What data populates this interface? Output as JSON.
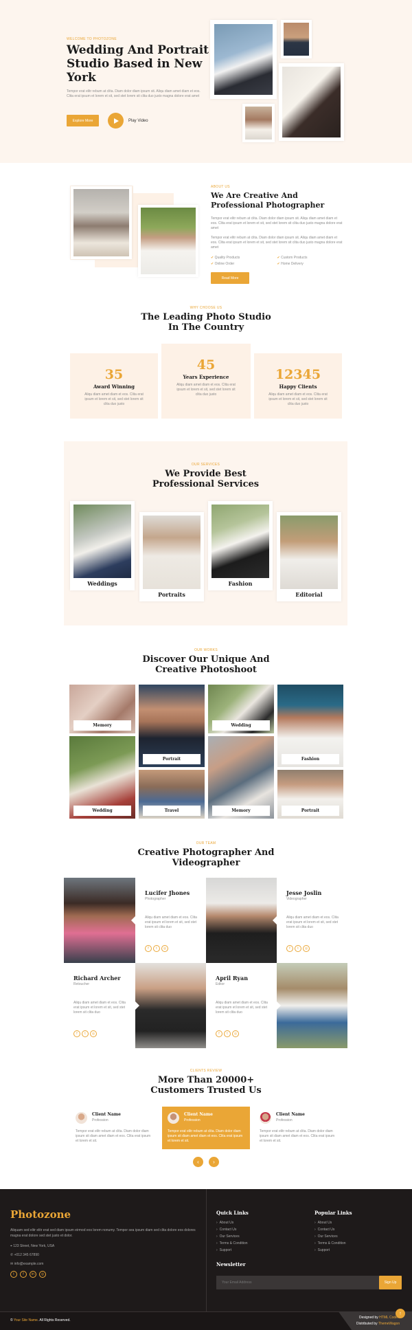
{
  "hero": {
    "eyebrow": "WELCOME TO PHOTOZONE",
    "title_l1": "Wedding And Portrait",
    "title_l2": "Studio Based in New",
    "title_l3": "York",
    "text": "Tempor erat elitr rebum at clita. Diam dolor diam ipsum sit. Aliqu diam amet diam et eos. Clita erat ipsum et lorem et sit, sed stet lorem sit clita duo justo magna dolore erat amet",
    "explore": "Explore More",
    "play": "Play Video"
  },
  "about": {
    "eyebrow": "ABOUT US",
    "title_l1": "We Are Creative And",
    "title_l2": "Professional Photographer",
    "p1": "Tempor erat elitr rebum at clita. Diam dolor diam ipsum sit. Aliqu diam amet diam et eos. Clita erat ipsum et lorem et sit, sed stet lorem sit clita duo justo magna dolore erat amet",
    "p2": "Tempor erat elitr rebum at clita. Diam dolor diam ipsum sit. Aliqu diam amet diam et eos. Clita erat ipsum et lorem et sit, sed stet lorem sit clita duo justo magna dolore erat amet",
    "features": [
      "Quality Products",
      "Custom Products",
      "Online Order",
      "Home Delivery"
    ],
    "read_more": "Read More"
  },
  "why": {
    "eyebrow": "WHY CHOOSE US",
    "title_l1": "The Leading Photo Studio",
    "title_l2": "In The Country",
    "cards": [
      {
        "value": "35",
        "label": "Award Winning",
        "text": "Aliqu diam amet diam et eos. Clita erat ipsum et lorem et sit, sed stet lorem sit clita duo justo"
      },
      {
        "value": "45",
        "label": "Years Experience",
        "text": "Aliqu diam amet diam et eos. Clita erat ipsum et lorem et sit, sed stet lorem sit clita duo justo"
      },
      {
        "value": "12345",
        "label": "Happy Clients",
        "text": "Aliqu diam amet diam et eos. Clita erat ipsum et lorem et sit, sed stet lorem sit clita duo justo"
      }
    ]
  },
  "services": {
    "eyebrow": "OUR SERVICES",
    "title_l1": "We Provide Best",
    "title_l2": "Professional Services",
    "items": [
      "Weddings",
      "Portraits",
      "Fashion",
      "Editorial"
    ]
  },
  "works": {
    "eyebrow": "OUR WORKS",
    "title_l1": "Discover Our Unique And",
    "title_l2": "Creative Photoshoot",
    "labels": [
      "Memory",
      "Portrait",
      "Wedding",
      "Fashion",
      "Wedding",
      "Travel",
      "Memory",
      "Portrait"
    ]
  },
  "team": {
    "eyebrow": "OUR TEAM",
    "title_l1": "Creative Photographer And",
    "title_l2": "Videographer",
    "members": [
      {
        "name": "Lucifer Jhones",
        "role": "Photographer",
        "text": "Aliqu diam amet diam et eos. Clita erat ipsum et lorem et sit, sed stet lorem sit clita duo"
      },
      {
        "name": "Jesse Joslin",
        "role": "Videographer",
        "text": "Aliqu diam amet diam et eos. Clita erat ipsum et lorem et sit, sed stet lorem sit clita duo"
      },
      {
        "name": "Richard Archer",
        "role": "Retoucher",
        "text": "Aliqu diam amet diam et eos. Clita erat ipsum et lorem et sit, sed stet lorem sit clita duo"
      },
      {
        "name": "April Ryan",
        "role": "Editor",
        "text": "Aliqu diam amet diam et eos. Clita erat ipsum et lorem et sit, sed stet lorem sit clita duo"
      }
    ]
  },
  "testimonials": {
    "eyebrow": "CLIENTS REVIEW",
    "title_l1": "More Than 20000+",
    "title_l2": "Customers Trusted Us",
    "items": [
      {
        "name": "Client Name",
        "role": "Profession",
        "text": "Tempor erat elitr rebum at clita. Diam dolor diam ipsum sit diam amet diam et eos. Clita erat ipsum et lorem et sit."
      },
      {
        "name": "Client Name",
        "role": "Profession",
        "text": "Tempor erat elitr rebum at clita. Diam dolor diam ipsum sit diam amet diam et eos. Clita erat ipsum et lorem et sit."
      },
      {
        "name": "Client Name",
        "role": "Profession",
        "text": "Tempor erat elitr rebum at clita. Diam dolor diam ipsum sit diam amet diam et eos. Clita erat ipsum et lorem et sit."
      }
    ]
  },
  "footer": {
    "brand": "Photozone",
    "about": "Aliquam sed elitr elitr erat sed diam ipsum eirmod eos lorem nonumy. Tempor sea ipsum diam sed clita dolore eos dolores magna erat dolore sed stet justo et dolor.",
    "address": "123 Street, New York, USA",
    "phone": "+012 345 67890",
    "email": "info@example.com",
    "quick_title": "Quick Links",
    "quick_links": [
      "About Us",
      "Contact Us",
      "Our Services",
      "Terms & Condition",
      "Support"
    ],
    "popular_title": "Popular Links",
    "popular_links": [
      "About Us",
      "Contact Us",
      "Our Services",
      "Terms & Condition",
      "Support"
    ],
    "newsletter_title": "Newsletter",
    "newsletter_placeholder": "Your Email Address",
    "signup": "Sign Up",
    "copyright_site": "Your Site Name",
    "copyright_rest": ". All Rights Reserved.",
    "designed_prefix": "Designed by ",
    "designed_by": "HTML Codex",
    "distributed_prefix": "Distributed by ",
    "distributed_by": "ThemeWagon"
  },
  "colors": {
    "accent": "#eaa636",
    "cream": "#fdf5ee",
    "dark": "#1e1a1a"
  }
}
